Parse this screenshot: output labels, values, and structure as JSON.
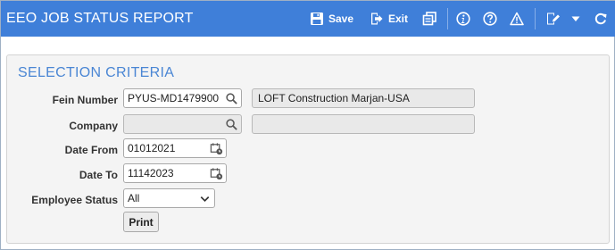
{
  "header": {
    "title": "EEO JOB STATUS REPORT",
    "save_label": "Save",
    "exit_label": "Exit"
  },
  "icons": {
    "save": "floppy-disk-icon",
    "exit": "exit-arrow-icon",
    "reports": "stacked-pages-icon",
    "info": "info-icon",
    "help": "question-icon",
    "alert": "warning-triangle-icon",
    "edit": "edit-note-icon",
    "dropdown": "caret-down-icon",
    "refresh": "refresh-icon"
  },
  "colors": {
    "header_bg": "#3f7fd9",
    "section_title": "#4a86d4"
  },
  "form": {
    "section_title": "SELECTION CRITERIA",
    "fein_label": "Fein Number",
    "fein_value": "PYUS-MD1479900",
    "fein_description": "LOFT Construction Marjan-USA",
    "company_label": "Company",
    "company_value": "",
    "company_description": "",
    "date_from_label": "Date From",
    "date_from_value": "01012021",
    "date_to_label": "Date To",
    "date_to_value": "11142023",
    "employee_status_label": "Employee Status",
    "employee_status_value": "All",
    "print_label": "Print"
  }
}
